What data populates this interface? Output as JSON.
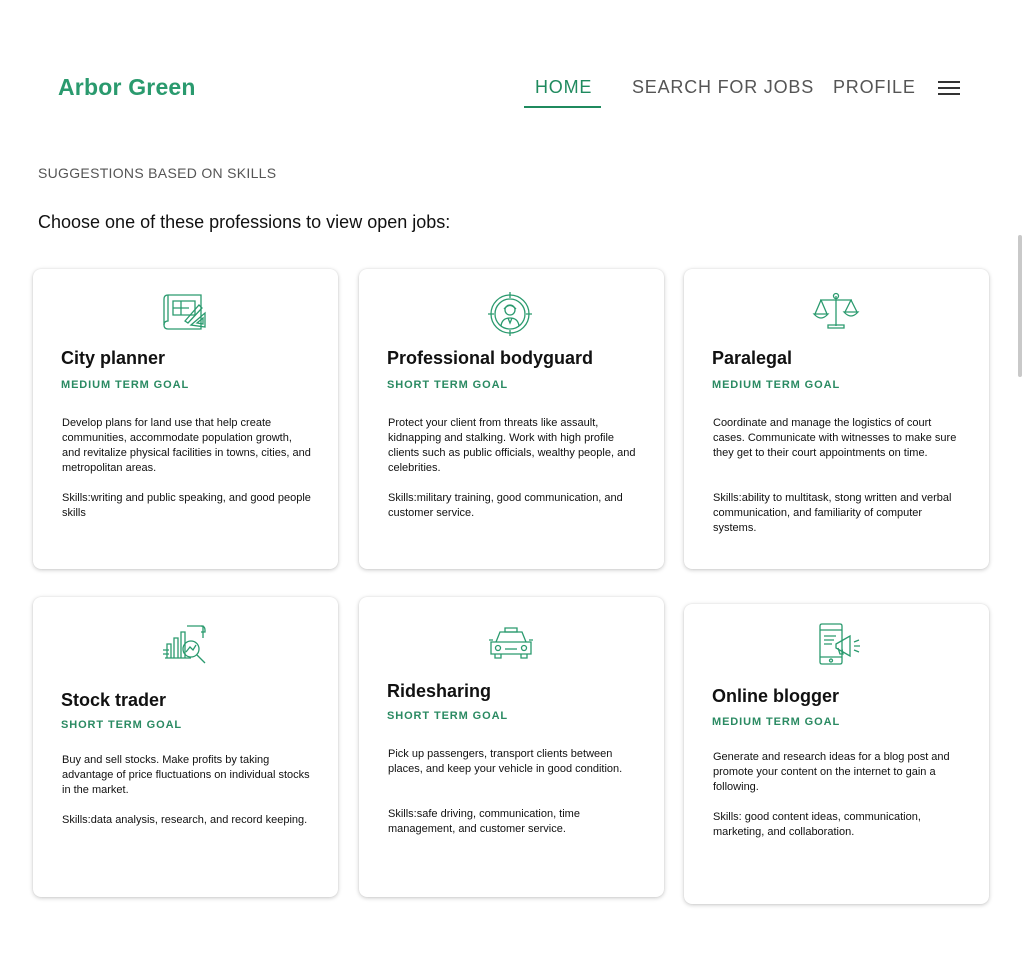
{
  "brand": "Arbor Green",
  "nav": {
    "home": "HOME",
    "search": "SEARCH FOR JOBS",
    "profile": "PROFILE"
  },
  "section_label": "SUGGESTIONS BASED ON SKILLS",
  "prompt": "Choose one of these professions to view open jobs:",
  "colors": {
    "accent": "#1f8a5e",
    "brand": "#2a9a6e"
  },
  "cards": [
    {
      "icon": "blueprint-icon",
      "title": "City planner",
      "goal": "MEDIUM TERM GOAL",
      "description": "Develop plans for land use that help create communities, accommodate population growth, and revitalize physical facilities in towns, cities, and metropolitan areas.",
      "skills": "Skills:writing and public speaking, and good people skills"
    },
    {
      "icon": "bodyguard-target-icon",
      "title": "Professional bodyguard",
      "goal": "SHORT TERM GOAL",
      "description": "Protect your client from threats like assault, kidnapping and stalking. Work with high profile clients such as public officials, wealthy people, and celebrities.",
      "skills": "Skills:military training, good communication, and customer service."
    },
    {
      "icon": "scales-of-justice-icon",
      "title": "Paralegal",
      "goal": "MEDIUM TERM GOAL",
      "description": "Coordinate and manage the logistics of court cases. Communicate with witnesses to make sure they get to their court appointments on time.",
      "skills": "Skills:ability to multitask, stong written and verbal communication, and familiarity of computer systems."
    },
    {
      "icon": "stock-chart-icon",
      "title": "Stock trader",
      "goal": "SHORT TERM GOAL",
      "description": "Buy and sell stocks. Make profits by taking advantage of price fluctuations on individual stocks in the market.",
      "skills": "Skills:data analysis, research, and record keeping."
    },
    {
      "icon": "taxi-car-icon",
      "title": "Ridesharing",
      "goal": "SHORT TERM GOAL",
      "description": "Pick up passengers, transport clients between places, and keep your vehicle in good condition.",
      "skills": "Skills:safe driving, communication, time management, and customer service."
    },
    {
      "icon": "phone-megaphone-icon",
      "title": "Online blogger",
      "goal": "MEDIUM TERM GOAL",
      "description": "Generate and research ideas for a blog post and promote your content on the internet to gain a following.",
      "skills": "Skills: good content ideas, communication, marketing, and collaboration."
    }
  ]
}
